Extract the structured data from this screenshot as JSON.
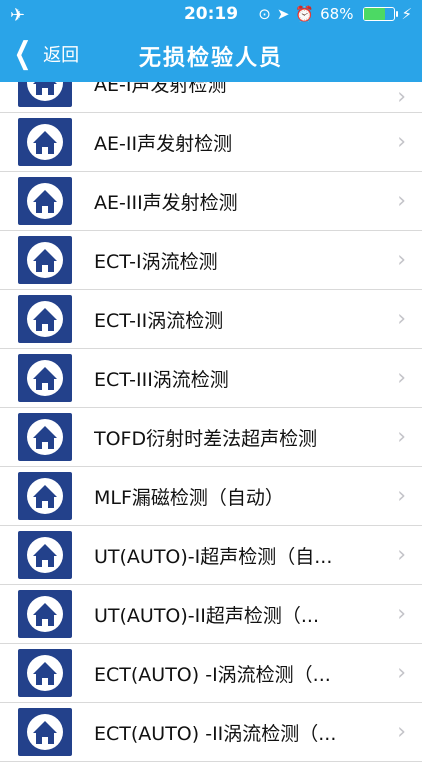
{
  "status": {
    "time": "20:19",
    "battery": "68%",
    "battery_level": 0.68
  },
  "nav": {
    "back_label": "返回",
    "title": "无损检验人员"
  },
  "items": [
    {
      "label": "AE-II声发射检测"
    },
    {
      "label": "AE-III声发射检测"
    },
    {
      "label": "ECT-I涡流检测"
    },
    {
      "label": "ECT-II涡流检测"
    },
    {
      "label": "ECT-III涡流检测"
    },
    {
      "label": "TOFD衍射时差法超声检测"
    },
    {
      "label": "MLF漏磁检测（自动）"
    },
    {
      "label": "UT(AUTO)-I超声检测（自..."
    },
    {
      "label": "UT(AUTO)-II超声检测（..."
    },
    {
      "label": "ECT(AUTO) -I涡流检测（..."
    },
    {
      "label": "ECT(AUTO) -II涡流检测（..."
    }
  ],
  "partial_item": {
    "label": "AE-I声发射检测"
  },
  "colors": {
    "header": "#2aa4e8",
    "thumb": "#23418b"
  }
}
